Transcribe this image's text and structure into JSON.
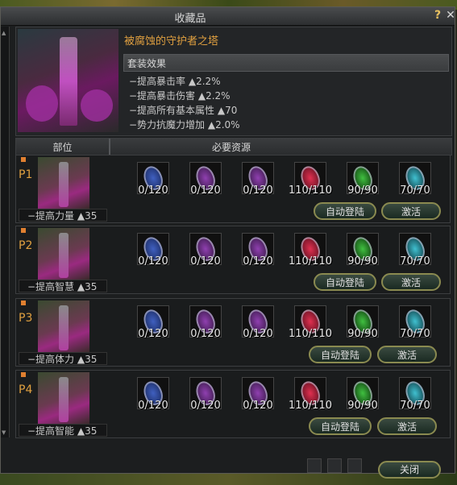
{
  "window": {
    "title": "收藏品"
  },
  "set": {
    "name": "被腐蚀的守护者之塔",
    "effects_title": "套装效果",
    "effects": [
      "−提高暴击率 ▲2.2%",
      "−提高暴击伤害 ▲2.2%",
      "−提高所有基本属性 ▲70",
      "−势力抗魔力增加 ▲2.0%"
    ]
  },
  "columns": {
    "part": "部位",
    "resources": "必要资源"
  },
  "rows": [
    {
      "label": "P1",
      "bonus": "−提高力量 ▲35",
      "counts": [
        "0/120",
        "0/120",
        "0/120",
        "110/110",
        "90/90",
        "70/70"
      ],
      "auto_label": "自动登陆",
      "activate_label": "激活"
    },
    {
      "label": "P2",
      "bonus": "−提高智慧 ▲35",
      "counts": [
        "0/120",
        "0/120",
        "0/120",
        "110/110",
        "90/90",
        "70/70"
      ],
      "auto_label": "自动登陆",
      "activate_label": "激活"
    },
    {
      "label": "P3",
      "bonus": "−提高体力 ▲35",
      "counts": [
        "0/120",
        "0/120",
        "0/120",
        "110/110",
        "90/90",
        "70/70"
      ],
      "auto_label": "自动登陆",
      "activate_label": "激活"
    },
    {
      "label": "P4",
      "bonus": "−提高智能 ▲35",
      "counts": [
        "0/120",
        "0/120",
        "0/120",
        "110/110",
        "90/90",
        "70/70"
      ],
      "auto_label": "自动登陆",
      "activate_label": "激活"
    }
  ],
  "gem_colors": [
    "blue-gem-icon",
    "purple-gem-icon",
    "purple-gem-icon",
    "red-gem-icon",
    "green-gem-icon",
    "cyan-gem-icon"
  ],
  "footer": {
    "close_label": "关闭"
  },
  "colors": {
    "accent": "#e0a040",
    "button_border": "#8a8a50"
  }
}
